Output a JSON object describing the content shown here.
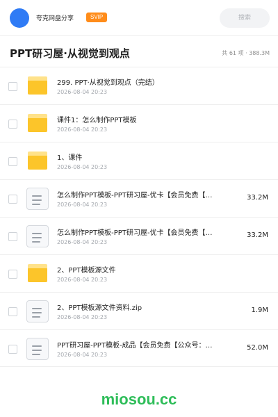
{
  "topbar": {
    "app_name": "夸克网盘分享",
    "badge": "SVIP",
    "search_placeholder": "搜索",
    "avatar_color": "#2f7bf5",
    "badge_color": "#ff8c1a"
  },
  "header": {
    "title": "PPT研习屋·从视觉到观点",
    "summary": "共 61 项 · 388.3M"
  },
  "files": [
    {
      "type": "folder",
      "icon": "folder-icon",
      "name": "299. PPT·从视觉到观点（完结）",
      "date": "2026-08-04 20:23",
      "size": ""
    },
    {
      "type": "folder",
      "icon": "folder-icon",
      "name": "课件1：怎么制作PPT模板",
      "date": "2026-08-04 20:23",
      "size": ""
    },
    {
      "type": "folder",
      "icon": "folder-icon",
      "name": "1、课件",
      "date": "2026-08-04 20:23",
      "size": ""
    },
    {
      "type": "file",
      "icon": "document-icon",
      "name": "怎么制作PPT模板-PPT研习屋-优卡【会员免费【…",
      "date": "2026-08-04 20:23",
      "size": "33.2M"
    },
    {
      "type": "file",
      "icon": "document-icon",
      "name": "怎么制作PPT模板-PPT研习屋-优卡【会员免费【…",
      "date": "2026-08-04 20:23",
      "size": "33.2M"
    },
    {
      "type": "folder",
      "icon": "folder-icon",
      "name": "2、PPT模板源文件",
      "date": "2026-08-04 20:23",
      "size": ""
    },
    {
      "type": "file",
      "icon": "document-icon",
      "name": "2、PPT模板源文件资料.zip",
      "date": "2026-08-04 20:23",
      "size": "1.9M"
    },
    {
      "type": "file",
      "icon": "document-icon",
      "name": "PPT研习屋-PPT模板-成品【会员免费【公众号：…",
      "date": "2026-08-04 20:23",
      "size": "52.0M"
    }
  ],
  "colors": {
    "folder": "#fcc52a",
    "watermark": "#2ebd59"
  },
  "watermark": "miosou.cc"
}
